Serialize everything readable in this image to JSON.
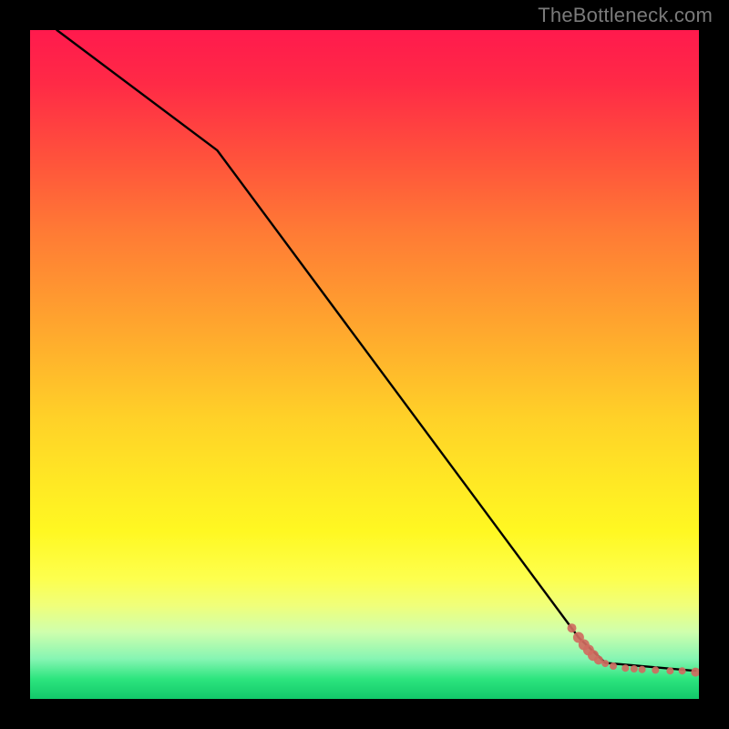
{
  "watermark": "TheBottleneck.com",
  "chart_data": {
    "type": "line",
    "title": "",
    "xlabel": "",
    "ylabel": "",
    "xlim": [
      0,
      100
    ],
    "ylim": [
      0,
      100
    ],
    "grid": false,
    "legend": false,
    "series": [
      {
        "name": "curve",
        "style": "solid-black",
        "x": [
          4,
          28,
          82,
          86,
          99.5
        ],
        "y": [
          100,
          82,
          9.2,
          5.4,
          4.2
        ]
      },
      {
        "name": "highlight-points",
        "style": "salmon-dots",
        "points": [
          {
            "x": 81.0,
            "y": 10.6,
            "r": 5
          },
          {
            "x": 82.0,
            "y": 9.2,
            "r": 6
          },
          {
            "x": 82.8,
            "y": 8.1,
            "r": 6
          },
          {
            "x": 83.5,
            "y": 7.3,
            "r": 6
          },
          {
            "x": 84.2,
            "y": 6.5,
            "r": 6
          },
          {
            "x": 85.0,
            "y": 5.8,
            "r": 5
          },
          {
            "x": 86.0,
            "y": 5.3,
            "r": 4
          },
          {
            "x": 87.2,
            "y": 4.9,
            "r": 4
          },
          {
            "x": 89.0,
            "y": 4.6,
            "r": 4
          },
          {
            "x": 90.3,
            "y": 4.5,
            "r": 4
          },
          {
            "x": 91.5,
            "y": 4.4,
            "r": 4
          },
          {
            "x": 93.5,
            "y": 4.3,
            "r": 4
          },
          {
            "x": 95.7,
            "y": 4.2,
            "r": 4
          },
          {
            "x": 97.5,
            "y": 4.2,
            "r": 4
          },
          {
            "x": 99.5,
            "y": 4.0,
            "r": 5
          }
        ]
      }
    ],
    "background_gradient": {
      "top": "#ff1a4d",
      "mid": "#ffe924",
      "bottom": "#12c86a"
    }
  }
}
